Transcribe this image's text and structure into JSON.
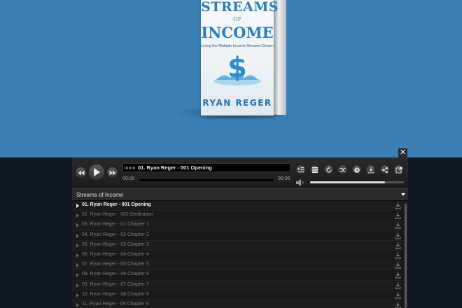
{
  "book": {
    "title_line1": "STREAMS",
    "title_line2": "OF",
    "title_line3": "INCOME",
    "subtitle": "Living the Multiple Income Streams Dream",
    "author": "RYAN REGER"
  },
  "close_label": "✕",
  "player": {
    "current_track": "01. Ryan Reger - 001 Opening",
    "time_elapsed": "00:00",
    "time_total": "00:00",
    "volume": 0.8,
    "progress": 0
  },
  "playlist": {
    "title": "Streams of Income",
    "tracks": [
      "01. Ryan Reger - 001 Opening",
      "02. Ryan Reger - 002 Dedication",
      "03. Ryan Reger - 01 Chapter 1",
      "04. Ryan Reger - 02 Chapter 2",
      "05. Ryan Reger - 03 Chapter 3",
      "06. Ryan Reger - 04 Chapter 4",
      "07. Ryan Reger - 05 Chapter 5",
      "08. Ryan Reger - 06 Chapter 6",
      "09. Ryan Reger - 07 Chapter 7",
      "10. Ryan Reger - 08 Chapter 8",
      "11. Ryan Reger - 09 Chapter 9"
    ],
    "active_index": 0
  },
  "icons": {
    "prev": "prev-icon",
    "play": "play-icon",
    "next": "next-icon",
    "playlist_toggle": "playlist-icon",
    "list": "list-icon",
    "repeat": "repeat-icon",
    "shuffle": "shuffle-icon",
    "timer": "clock-icon",
    "download": "download-icon",
    "share": "share-icon",
    "popout": "popout-icon",
    "volume": "speaker-icon"
  },
  "colors": {
    "hero_bg": "#3b7fb4",
    "player_bg": "#151515",
    "page_bg": "#0f1923",
    "book_blue": "#2b7fb8"
  }
}
